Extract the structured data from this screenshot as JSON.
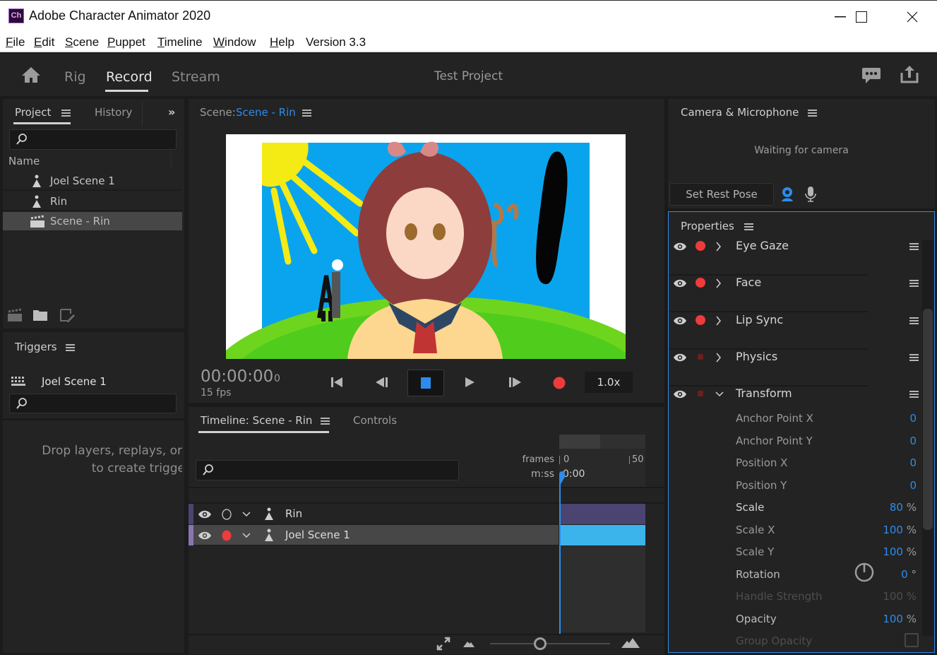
{
  "window": {
    "app_icon": "Ch",
    "title": "Adobe Character Animator 2020",
    "controls": [
      "minimize-icon",
      "maximize-icon",
      "close-icon"
    ]
  },
  "menubar": {
    "items": [
      {
        "label": "File",
        "mnemonic": "F",
        "rest": "ile"
      },
      {
        "label": "Edit",
        "mnemonic": "E",
        "rest": "dit"
      },
      {
        "label": "Scene",
        "mnemonic": "S",
        "rest": "cene"
      },
      {
        "label": "Puppet",
        "mnemonic": "P",
        "rest": "uppet"
      },
      {
        "label": "Timeline",
        "mnemonic": "T",
        "rest": "imeline"
      },
      {
        "label": "Window",
        "mnemonic": "W",
        "rest": "indow"
      },
      {
        "label": "Help",
        "mnemonic": "H",
        "rest": "elp"
      },
      {
        "label": "Version 3.3"
      }
    ]
  },
  "appbar": {
    "home_icon": "home-icon",
    "tabs": [
      "Rig",
      "Record",
      "Stream"
    ],
    "active_tab": "Record",
    "project_name": "Test Project",
    "right_icons": [
      "feedback-icon",
      "share-icon"
    ]
  },
  "project_panel": {
    "tabs": [
      "Project",
      "History"
    ],
    "active_tab": "Project",
    "search_placeholder": "",
    "column_header": "Name",
    "items": [
      {
        "name": "Joel Scene 1",
        "type": "puppet",
        "selected": false
      },
      {
        "name": "Rin",
        "type": "puppet",
        "selected": false
      },
      {
        "name": "Scene - Rin",
        "type": "scene",
        "selected": true
      }
    ],
    "footer_icons": [
      "new-scene-icon",
      "new-folder-icon",
      "edit-icon"
    ]
  },
  "triggers_panel": {
    "title": "Triggers",
    "puppet": "Joel Scene 1",
    "search_placeholder": "",
    "empty_message_line1": "Drop layers, replays, or",
    "empty_message_line2": "to create trigge"
  },
  "scene_panel": {
    "label": "Scene:",
    "scene_name": "Scene - Rin",
    "timecode": "00:00:00",
    "frame": "0",
    "fps": "15 fps",
    "speed": "1.0x",
    "transport": [
      "go-to-start-icon",
      "step-back-icon",
      "stop-icon",
      "play-icon",
      "step-forward-icon",
      "record-icon"
    ]
  },
  "timeline_panel": {
    "tabs": [
      "Timeline: Scene - Rin",
      "Controls"
    ],
    "active_tab": "Timeline: Scene - Rin",
    "search_placeholder": "",
    "ruler": {
      "frames_label": "frames",
      "mss_label": "m:ss",
      "frame_ticks": [
        "0",
        "50"
      ],
      "time_value": "0:00"
    },
    "tracks": [
      {
        "name": "Rin",
        "armed": false,
        "color": "#4b4470",
        "bar_color": "#4b4470"
      },
      {
        "name": "Joel Scene 1",
        "armed": true,
        "color": "#8a75b0",
        "bar_color": "#3bb4ec",
        "selected": true
      }
    ]
  },
  "camera_panel": {
    "title": "Camera & Microphone",
    "status": "Waiting for camera",
    "set_rest_pose": "Set Rest Pose"
  },
  "properties_panel": {
    "title": "Properties",
    "groups": [
      {
        "name": "Eye Gaze",
        "armed": true,
        "expanded": false
      },
      {
        "name": "Face",
        "armed": true,
        "expanded": false
      },
      {
        "name": "Lip Sync",
        "armed": true,
        "expanded": false
      },
      {
        "name": "Physics",
        "armed": false,
        "expanded": false
      },
      {
        "name": "Transform",
        "armed": false,
        "expanded": true
      }
    ],
    "transform": [
      {
        "name": "Anchor Point X",
        "value": "0",
        "unit": ""
      },
      {
        "name": "Anchor Point Y",
        "value": "0",
        "unit": ""
      },
      {
        "name": "Position X",
        "value": "0",
        "unit": ""
      },
      {
        "name": "Position Y",
        "value": "0",
        "unit": ""
      },
      {
        "name": "Scale",
        "value": "80",
        "unit": "%"
      },
      {
        "name": "Scale X",
        "value": "100",
        "unit": "%"
      },
      {
        "name": "Scale Y",
        "value": "100",
        "unit": "%"
      },
      {
        "name": "Rotation",
        "value": "0",
        "unit": "°"
      },
      {
        "name": "Handle Strength",
        "value": "100",
        "unit": "%",
        "disabled": true
      },
      {
        "name": "Opacity",
        "value": "100",
        "unit": "%"
      },
      {
        "name": "Group Opacity",
        "checked": false,
        "disabled": true
      }
    ]
  },
  "zoom_controls": {
    "slider_value": 0.5
  },
  "colors": {
    "accent_blue": "#2d8ceb",
    "record_red": "#ee3b3b",
    "panel_bg": "#232323"
  }
}
